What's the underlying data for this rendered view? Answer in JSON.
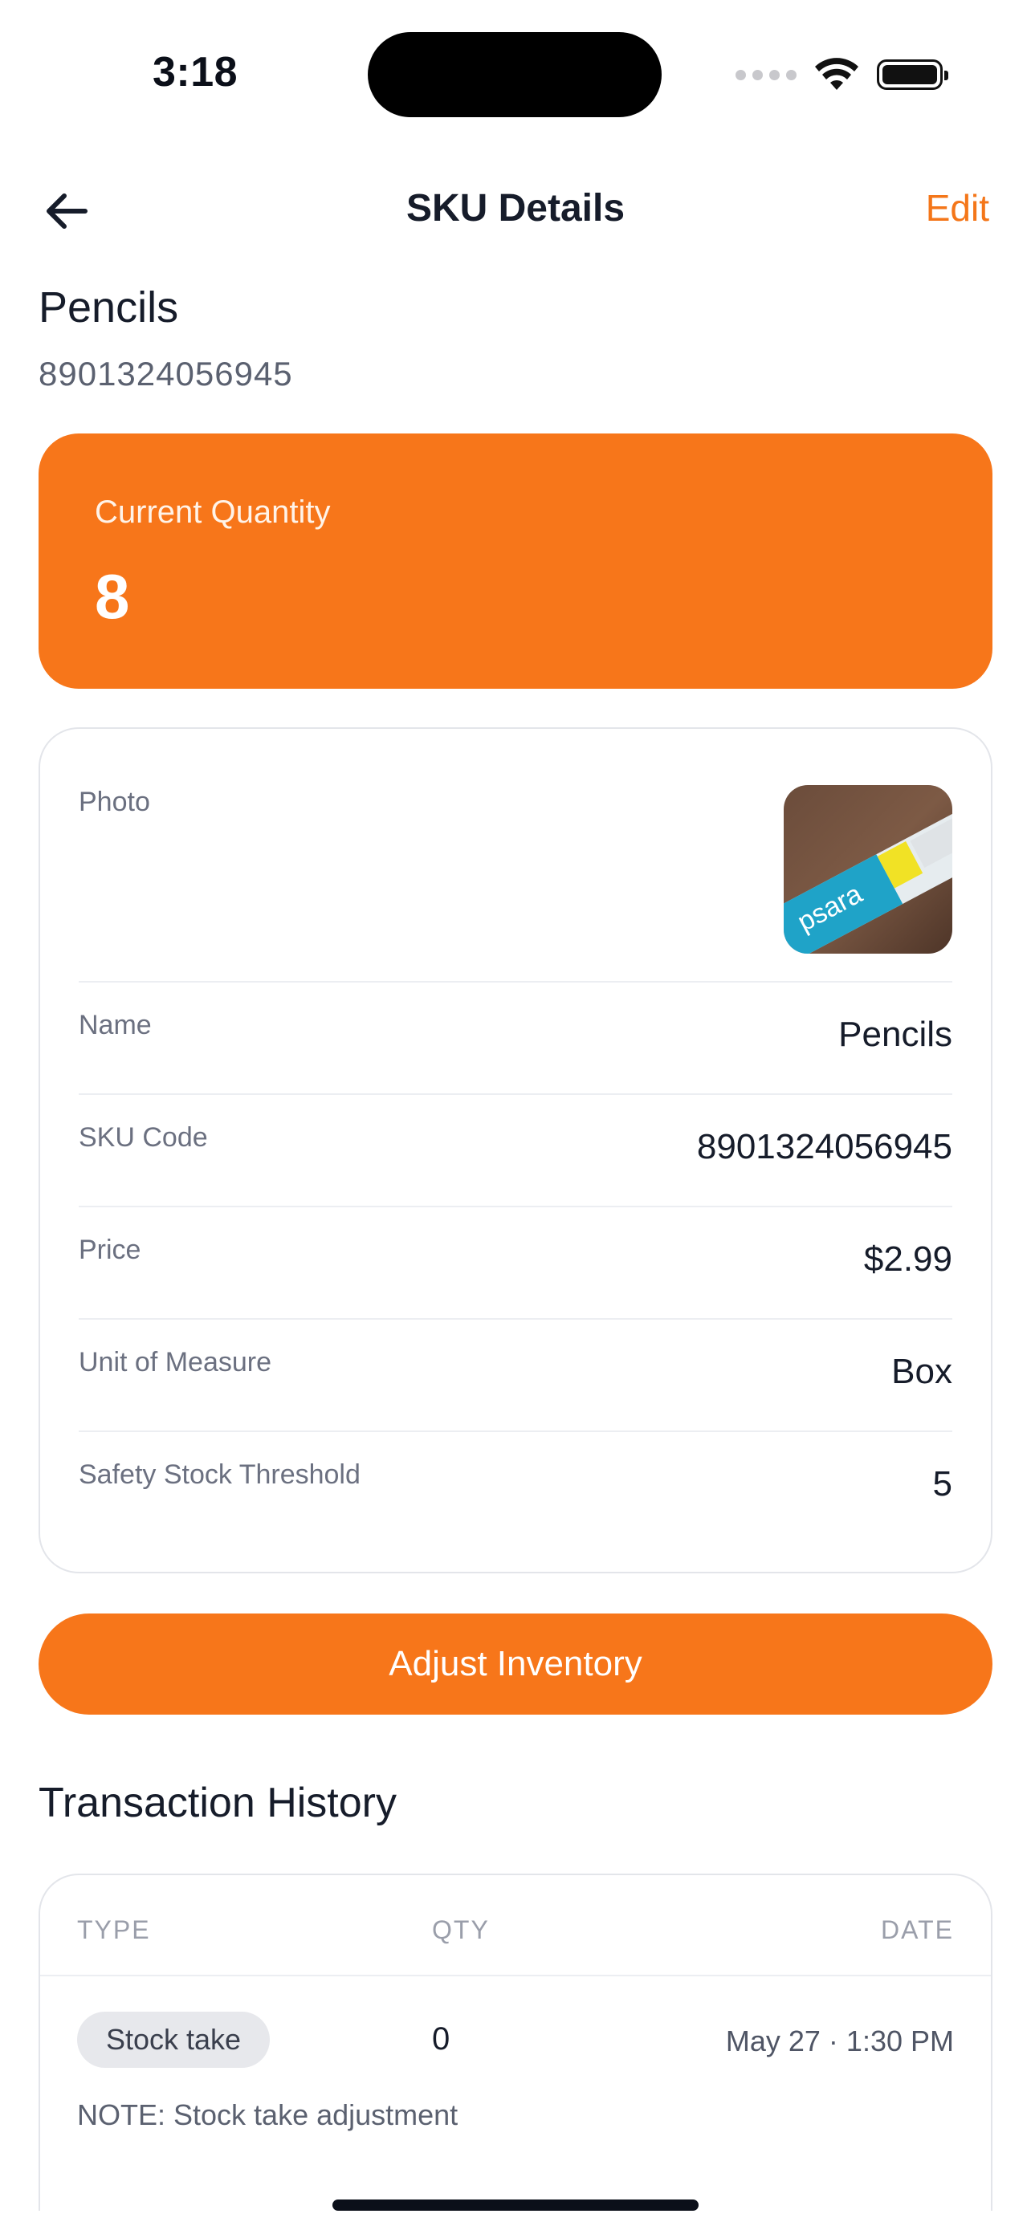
{
  "status_bar": {
    "time": "3:18"
  },
  "nav": {
    "title": "SKU Details",
    "edit_label": "Edit"
  },
  "sku": {
    "name": "Pencils",
    "code": "8901324056945"
  },
  "quantity": {
    "label": "Current Quantity",
    "value": "8"
  },
  "details": {
    "photo_label": "Photo",
    "photo_text": "psara",
    "rows": [
      {
        "label": "Name",
        "value": "Pencils"
      },
      {
        "label": "SKU Code",
        "value": "8901324056945"
      },
      {
        "label": "Price",
        "value": "$2.99"
      },
      {
        "label": "Unit of Measure",
        "value": "Box"
      },
      {
        "label": "Safety Stock Threshold",
        "value": "5"
      }
    ]
  },
  "actions": {
    "adjust_label": "Adjust Inventory"
  },
  "history": {
    "title": "Transaction History",
    "columns": [
      "TYPE",
      "QTY",
      "DATE"
    ],
    "rows": [
      {
        "type": "Stock take",
        "qty": "0",
        "date": "May 27 · 1:30 PM",
        "note": "NOTE: Stock take adjustment"
      }
    ]
  },
  "colors": {
    "accent": "#f7761a",
    "text": "#161c2a",
    "muted": "#6b7080"
  }
}
